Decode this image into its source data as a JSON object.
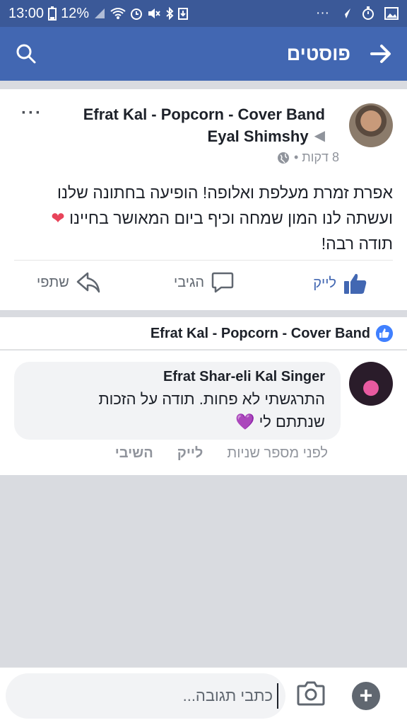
{
  "status_bar": {
    "time": "13:00",
    "battery": "12%",
    "more": "···"
  },
  "header": {
    "title": "פוסטים",
    "back_icon": "arrow-right-icon",
    "search_icon": "search-icon"
  },
  "post": {
    "author": "Efrat Kal - Popcorn -  Cover Band",
    "recipient": "Eyal Shimshy",
    "more": "···",
    "time": "8 דקות •",
    "line1": "אפרת זמרת מעלפת ואלופה! הופיעה בחתונה שלנו",
    "line2": "ועשתה לנו המון שמחה וכיף ביום המאושר בחיינו",
    "heart": "❤",
    "line3": "תודה רבה!",
    "actions": {
      "like": "לייק",
      "comment": "הגיבי",
      "share": "שתפי"
    }
  },
  "liked_by": {
    "text": "Efrat Kal - Popcorn -  Cover Band"
  },
  "comment": {
    "author": "Efrat Shar-eli Kal Singer",
    "line1": "התרגשתי לא פחות. תודה על הזכות",
    "line2": "שנתתם לי",
    "heart": "💜",
    "time": "לפני מספר שניות",
    "like": "לייק",
    "reply": "השיבי"
  },
  "composer": {
    "placeholder": "כתבי תגובה..."
  },
  "colors": {
    "facebook_blue": "#4267b2",
    "status_bar": "#3b5998"
  }
}
